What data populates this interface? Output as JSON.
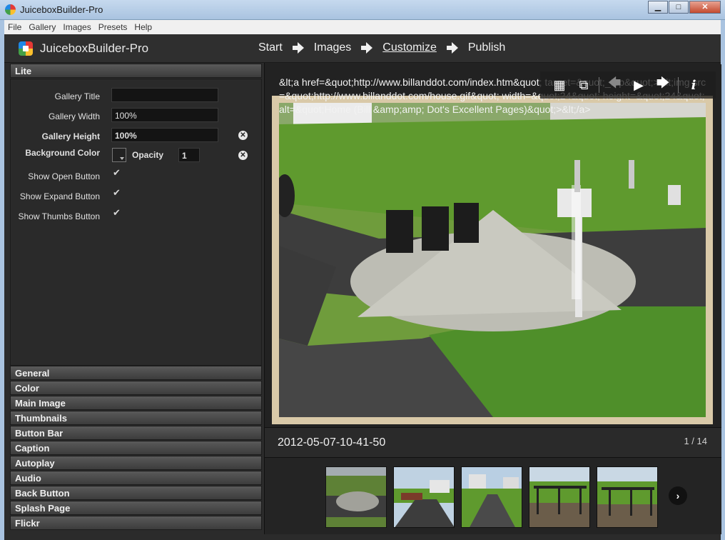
{
  "window": {
    "title": "JuiceboxBuilder-Pro",
    "minimize": "▁",
    "maximize": "□",
    "close": "✕"
  },
  "menu": [
    "File",
    "Gallery",
    "Images",
    "Presets",
    "Help"
  ],
  "header": {
    "app_name": "JuiceboxBuilder-Pro",
    "steps": [
      "Start",
      "Images",
      "Customize",
      "Publish"
    ],
    "active_step": "Customize"
  },
  "left": {
    "lite_header": "Lite",
    "fields": {
      "gallery_title": {
        "label": "Gallery Title",
        "value": ""
      },
      "gallery_width": {
        "label": "Gallery Width",
        "value": "100%"
      },
      "gallery_height": {
        "label": "Gallery Height",
        "value": "100%"
      },
      "background_color": {
        "label": "Background Color"
      },
      "opacity": {
        "label": "Opacity",
        "value": "1"
      },
      "show_open_button": {
        "label": "Show Open Button",
        "checked": true
      },
      "show_expand_button": {
        "label": "Show Expand Button",
        "checked": true
      },
      "show_thumbs_button": {
        "label": "Show Thumbs Button",
        "checked": true
      }
    },
    "clear_glyph": "✕",
    "check_glyph": "✔",
    "sections": [
      "General",
      "Color",
      "Main Image",
      "Thumbnails",
      "Button Bar",
      "Caption",
      "Autoplay",
      "Audio",
      "Back Button",
      "Splash Page",
      "Flickr"
    ]
  },
  "preview": {
    "overlay_text": "&lt;a href=&quot;http://www.billanddot.com/index.htm&quot; target=&quot;_top&quot;>&lt;img src=&quot;http://www.billanddot.com/house.gif&quot; width=&quot;24&quot; height=&quot;24&quot; alt=&quot;Home (Bill &amp;amp; Dot's Excellent Pages)&quot;>&lt;/a>",
    "button_bar": {
      "thumbs": "▦",
      "expand": "⧉",
      "prev": "🡄",
      "play": "▶",
      "next": "🡆",
      "info": "i"
    },
    "caption_title": "2012-05-07-10-41-50",
    "counter": "1 / 14",
    "thumb_next": "›"
  },
  "colors": {
    "accent": "#e8e8e8",
    "panel": "#2b2b2b",
    "frame": "#d9c9a8"
  }
}
